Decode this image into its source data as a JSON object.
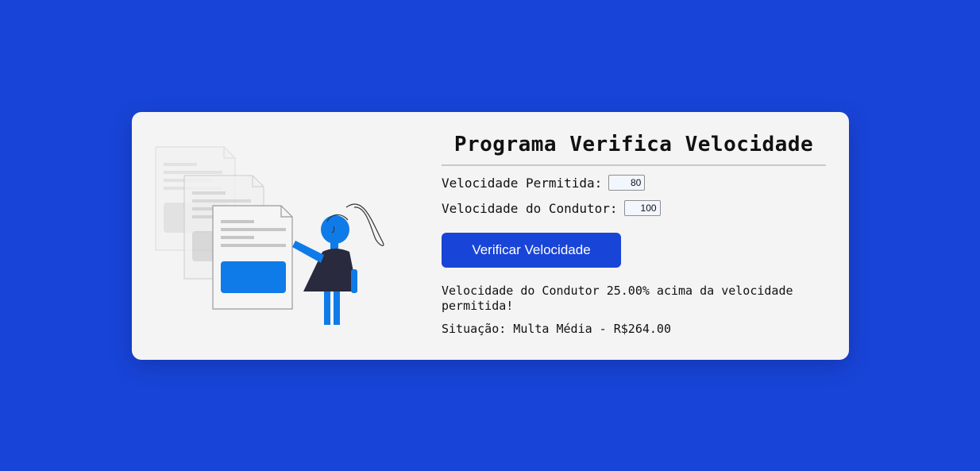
{
  "title": "Programa Verifica Velocidade",
  "form": {
    "allowed_label": "Velocidade Permitida:",
    "allowed_value": "80",
    "driver_label": "Velocidade do Condutor:",
    "driver_value": "100",
    "button_label": "Verificar Velocidade"
  },
  "result": {
    "message": "Velocidade do Condutor 25.00% acima da velocidade permitida!",
    "situation": "Situação: Multa Média - R$264.00"
  },
  "colors": {
    "background": "#1844d8",
    "card": "#f4f4f5",
    "accent": "#1844d8",
    "figure_blue": "#0f7be8"
  },
  "illustration": {
    "icon": "person-presenting-documents-icon"
  }
}
